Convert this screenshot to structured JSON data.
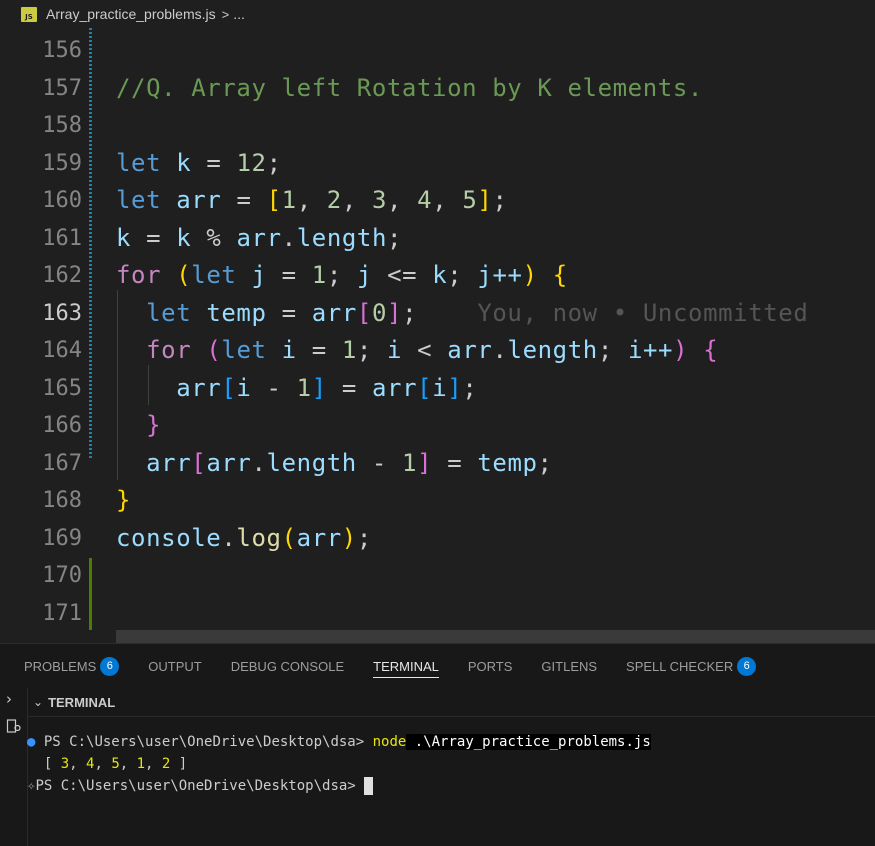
{
  "breadcrumb": {
    "icon_label": "JS",
    "file_name": "Array_practice_problems.js",
    "separator": ">",
    "more": "..."
  },
  "editor": {
    "active_line": "163",
    "lines": [
      {
        "number": "156"
      },
      {
        "number": "157"
      },
      {
        "number": "158"
      },
      {
        "number": "159"
      },
      {
        "number": "160"
      },
      {
        "number": "161"
      },
      {
        "number": "162"
      },
      {
        "number": "163"
      },
      {
        "number": "164"
      },
      {
        "number": "165"
      },
      {
        "number": "166"
      },
      {
        "number": "167"
      },
      {
        "number": "168"
      },
      {
        "number": "169"
      },
      {
        "number": "170"
      },
      {
        "number": "171"
      }
    ],
    "code": {
      "l157": "//Q. Array left Rotation by K elements.",
      "l159": [
        "let",
        "k",
        "=",
        "12",
        ";"
      ],
      "l160": [
        "let",
        "arr",
        "=",
        "[",
        "1",
        "2",
        "3",
        "4",
        "5",
        "]",
        ";"
      ],
      "l161": [
        "k",
        "=",
        "k",
        "%",
        "arr",
        ".",
        "length",
        ";"
      ],
      "l162": [
        "for",
        "(",
        "let",
        "j",
        "=",
        "1",
        ";",
        "j",
        "<=",
        "k",
        ";",
        "j++",
        ")",
        "{"
      ],
      "l163": [
        "let",
        "temp",
        "=",
        "arr",
        "[",
        "0",
        "]",
        ";"
      ],
      "l163_blame": "You, now • Uncommitted",
      "l164": [
        "for",
        "(",
        "let",
        "i",
        "=",
        "1",
        ";",
        "i",
        "<",
        "arr",
        ".",
        "length",
        ";",
        "i++",
        ")",
        "{"
      ],
      "l165": [
        "arr",
        "[",
        "i",
        "-",
        "1",
        "]",
        "=",
        "arr",
        "[",
        "i",
        "]",
        ";"
      ],
      "l166": "}",
      "l167": [
        "arr",
        "[",
        "arr",
        ".",
        "length",
        "-",
        "1",
        "]",
        "=",
        "temp",
        ";"
      ],
      "l168": "}",
      "l169": [
        "console",
        ".",
        "log",
        "(",
        "arr",
        ")",
        ";"
      ]
    }
  },
  "panel": {
    "tabs": [
      {
        "label": "PROBLEMS",
        "badge": "6"
      },
      {
        "label": "OUTPUT"
      },
      {
        "label": "DEBUG CONSOLE"
      },
      {
        "label": "TERMINAL",
        "active": true
      },
      {
        "label": "PORTS"
      },
      {
        "label": "GITLENS"
      },
      {
        "label": "SPELL CHECKER",
        "badge": "6"
      }
    ],
    "terminal_header": "TERMINAL",
    "terminal": {
      "prompt1": "PS C:\\Users\\user\\OneDrive\\Desktop\\dsa> ",
      "cmd_node": "node",
      "cmd_path": " .\\Array_practice_problems.js",
      "output_open": "[ ",
      "output_values": [
        "3",
        "4",
        "5",
        "1",
        "2"
      ],
      "output_close": " ]",
      "prompt2": "PS C:\\Users\\user\\OneDrive\\Desktop\\dsa> "
    }
  },
  "colors": {
    "accent": "#0078d4",
    "keyword": "#569cd6",
    "control": "#c586c0",
    "variable": "#9cdcfe",
    "number": "#b5cea8",
    "comment": "#6a9955",
    "function": "#dcdcaa"
  },
  "icons": [
    "js-file-icon",
    "chevron-right-icon",
    "chevron-down-icon",
    "ports-icon",
    "circle-dot-icon",
    "sparkle-prompt-icon"
  ]
}
